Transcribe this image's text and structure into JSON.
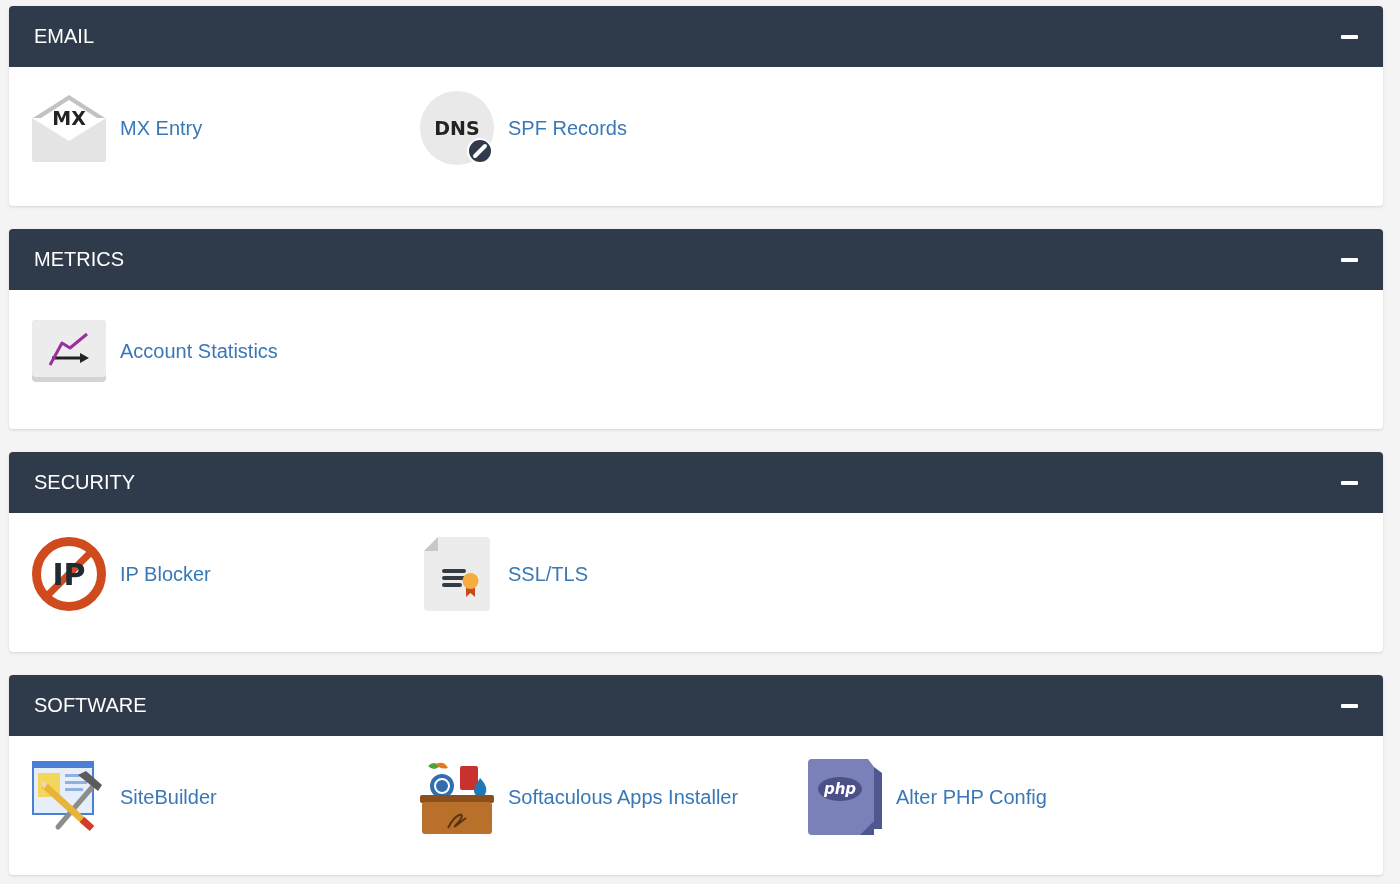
{
  "sections": [
    {
      "title": "EMAIL",
      "expanded": true,
      "items": [
        {
          "label": "MX Entry",
          "kind": "mx",
          "icon_text": "MX"
        },
        {
          "label": "SPF Records",
          "kind": "dns",
          "icon_text": "DNS"
        }
      ]
    },
    {
      "title": "METRICS",
      "expanded": true,
      "items": [
        {
          "label": "Account Statistics",
          "kind": "stats"
        }
      ]
    },
    {
      "title": "SECURITY",
      "expanded": true,
      "items": [
        {
          "label": "IP Blocker",
          "kind": "ipblock",
          "icon_text": "IP"
        },
        {
          "label": "SSL/TLS",
          "kind": "cert"
        }
      ]
    },
    {
      "title": "SOFTWARE",
      "expanded": true,
      "items": [
        {
          "label": "SiteBuilder",
          "kind": "sitebuilder"
        },
        {
          "label": "Softaculous Apps Installer",
          "kind": "toolbox"
        },
        {
          "label": "Alter PHP Config",
          "kind": "php",
          "icon_text": "php"
        }
      ]
    }
  ]
}
